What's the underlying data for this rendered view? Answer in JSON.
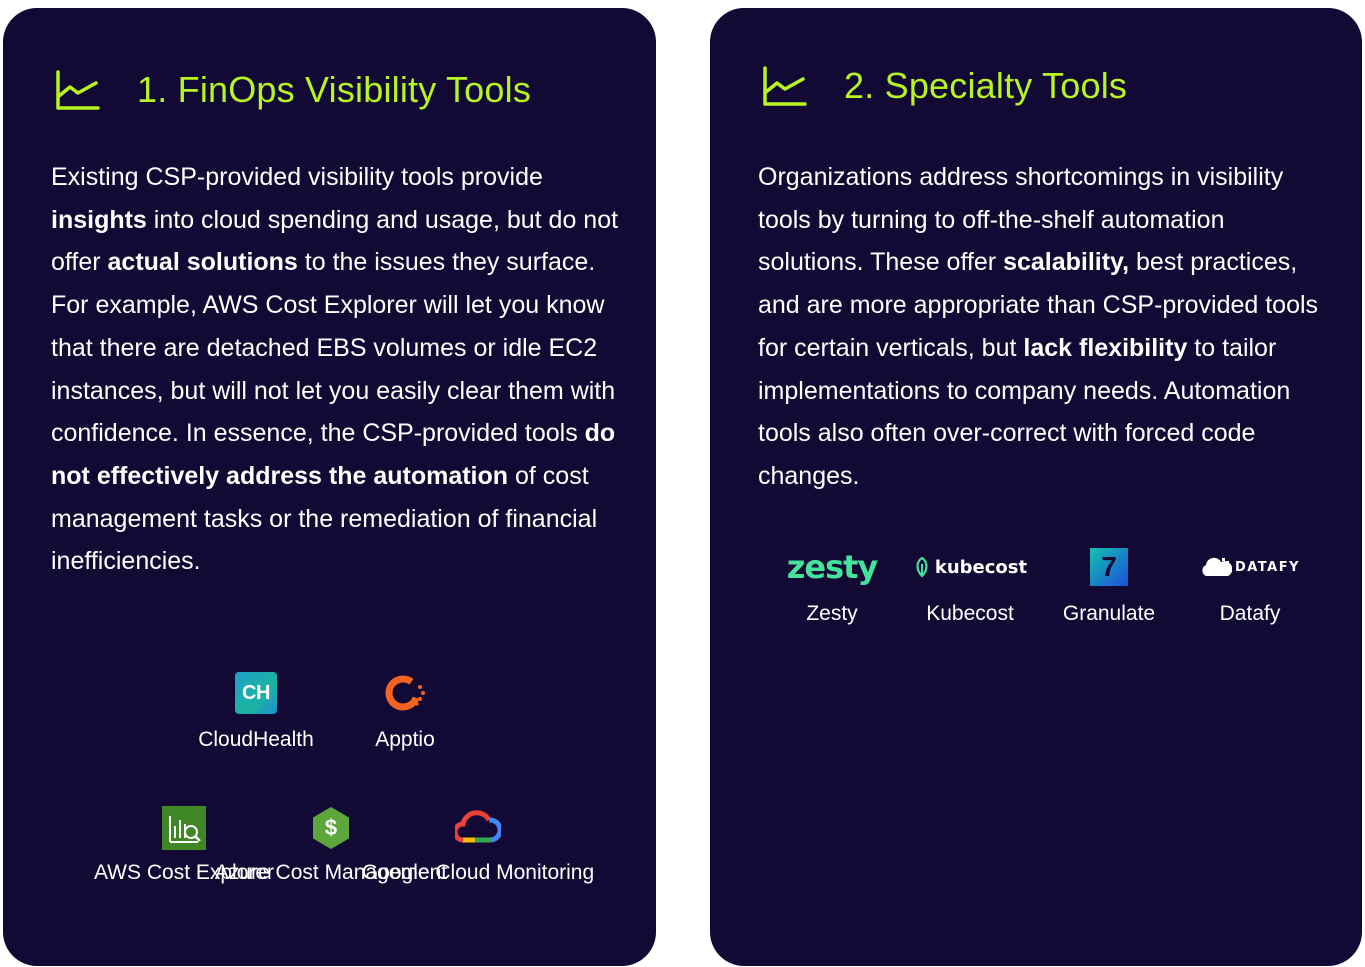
{
  "panels": [
    {
      "title": "1. FinOps Visibility Tools",
      "icon": "line-chart-icon",
      "body": [
        {
          "text": "Existing CSP-provided visibility tools provide ",
          "bold": false
        },
        {
          "text": "insights",
          "bold": true
        },
        {
          "text": " into cloud spending and usage, but do not offer ",
          "bold": false
        },
        {
          "text": "actual solutions",
          "bold": true
        },
        {
          "text": " to the issues they surface. For example, AWS Cost Explorer will let you know that there are detached EBS volumes or idle EC2 instances, but will not let you easily clear them with confidence. In essence, the CSP-provided tools ",
          "bold": false
        },
        {
          "text": "do not effectively address the automation",
          "bold": true
        },
        {
          "text": " of cost management tasks or the remediation of financial inefficiencies.",
          "bold": false
        }
      ],
      "tools": [
        {
          "label": "CloudHealth",
          "icon": "cloudhealth-logo"
        },
        {
          "label": "Apptio",
          "icon": "apptio-logo"
        },
        {
          "label": "AWS Cost Explorer",
          "icon": "aws-cost-explorer-logo"
        },
        {
          "label": "Azure Cost Management",
          "icon": "azure-cost-management-logo"
        },
        {
          "label": "Google Cloud Monitoring",
          "icon": "google-cloud-logo"
        }
      ]
    },
    {
      "title": "2. Specialty Tools",
      "icon": "line-chart-icon",
      "body": [
        {
          "text": "Organizations address shortcomings in visibility tools by turning to off-the-shelf automation solutions. These offer ",
          "bold": false
        },
        {
          "text": "scalability,",
          "bold": true
        },
        {
          "text": " best practices, and are more appropriate than CSP-provided tools for certain verticals, but ",
          "bold": false
        },
        {
          "text": "lack flexibility",
          "bold": true
        },
        {
          "text": " to tailor implementations to company needs.  Automation tools also often over-correct with forced code changes.",
          "bold": false
        }
      ],
      "tools": [
        {
          "label": "Zesty",
          "icon": "zesty-logo",
          "wordmark": "zesty"
        },
        {
          "label": "Kubecost",
          "icon": "kubecost-logo",
          "wordmark": "kubecost"
        },
        {
          "label": "Granulate",
          "icon": "granulate-logo"
        },
        {
          "label": "Datafy",
          "icon": "datafy-logo",
          "wordmark": "DATAFY"
        }
      ]
    }
  ],
  "logo_marks": {
    "cloudhealth": "CH",
    "azure": "$",
    "granulate": "7"
  },
  "colors": {
    "card_bg": "#120a35",
    "accent": "#b8f520",
    "text": "#ffffff",
    "page_bg": "#ffffff"
  }
}
